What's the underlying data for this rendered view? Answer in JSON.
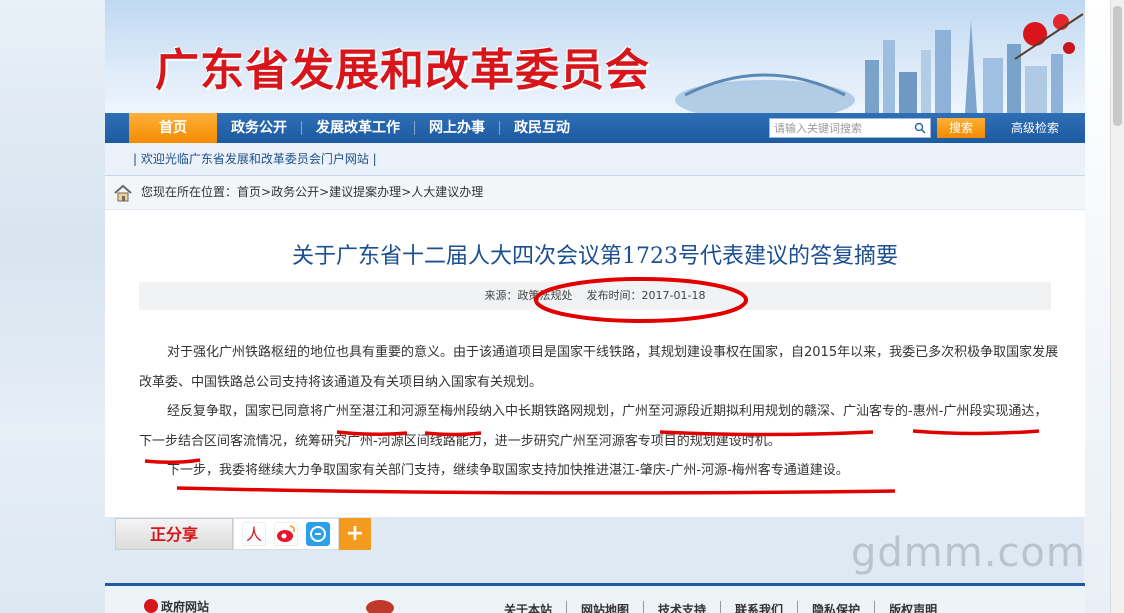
{
  "banner": {
    "title": "广东省发展和改革委员会"
  },
  "nav": {
    "items": [
      "首页",
      "政务公开",
      "发展改革工作",
      "网上办事",
      "政民互动"
    ],
    "search_placeholder": "请输入关键词搜索",
    "search_button": "搜索",
    "advanced_search": "高级检索"
  },
  "welcome": {
    "text": "| 欢迎光临广东省发展和改革委员会门户网站 |"
  },
  "breadcrumb": {
    "prefix": "您现在所在位置：",
    "items": [
      "首页",
      "政务公开",
      "建议提案办理",
      "人大建议办理"
    ],
    "sep": " > "
  },
  "article": {
    "title": "关于广东省十二届人大四次会议第1723号代表建议的答复摘要",
    "source_label": "来源：政策法规处",
    "date_label": "发布时间：2017-01-18",
    "paragraphs": [
      "对于强化广州铁路枢纽的地位也具有重要的意义。由于该通道项目是国家干线铁路，其规划建设事权在国家，自2015年以来，我委已多次积极争取国家发展改革委、中国铁路总公司支持将该通道及有关项目纳入国家有关规划。",
      "经反复争取，国家已同意将广州至湛江和河源至梅州段纳入中长期铁路网规划，广州至河源段近期拟利用规划的赣深、广汕客专的-惠州-广州段实现通达，下一步结合区间客流情况，统筹研究广州-河源区间线路能力，进一步研究广州至河源客专项目的规划建设时机。",
      "下一步，我委将继续大力争取国家有关部门支持，继续争取国家支持加快推进湛江-肇庆-广州-河源-梅州客专通道建设。"
    ]
  },
  "share": {
    "label": "正分享",
    "plus": "+"
  },
  "watermark": "gdmm.com",
  "footer": {
    "gov_label": "政府网站",
    "links": [
      "关于本站",
      "网站地图",
      "技术支持",
      "联系我们",
      "隐私保护",
      "版权声明"
    ]
  },
  "colors": {
    "brand_blue": "#1c5aa2",
    "accent_orange": "#f28b00",
    "title_red": "#d6161b",
    "annotation_red": "#e10000"
  }
}
